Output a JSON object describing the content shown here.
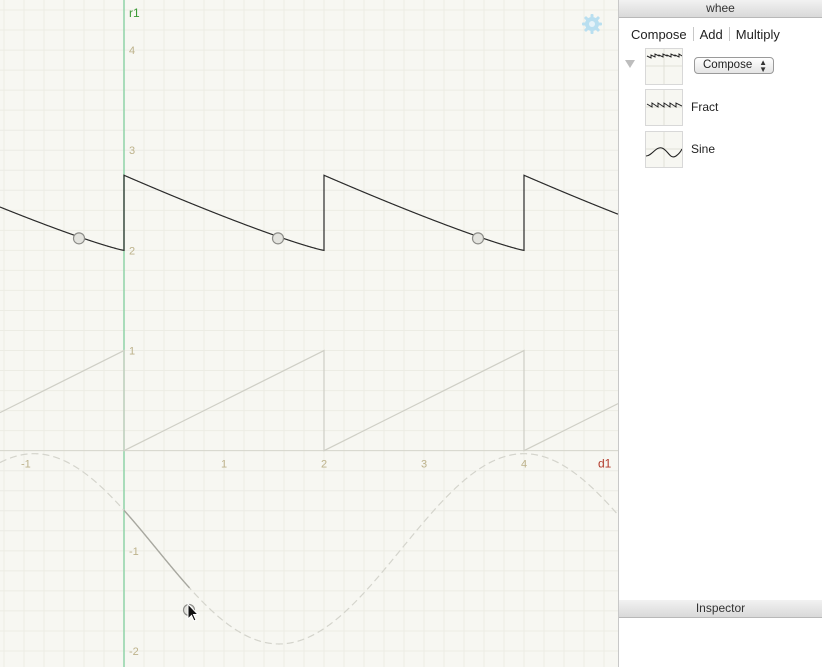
{
  "window": {
    "title": "whee"
  },
  "toolbar": {
    "compose": "Compose",
    "add": "Add",
    "multiply": "Multiply"
  },
  "functions": [
    {
      "label": "",
      "select": "Compose",
      "icon": "compose-icon"
    },
    {
      "label": "Fract",
      "icon": "fract-icon"
    },
    {
      "label": "Sine",
      "icon": "sine-icon"
    }
  ],
  "inspector": {
    "title": "Inspector"
  },
  "graph": {
    "x_axis_name": "d1",
    "y_axis_name": "r1",
    "x_ticks": [
      "-1",
      "1",
      "2",
      "3",
      "4"
    ],
    "y_ticks": [
      "4",
      "3",
      "2",
      "1",
      "-1",
      "-2"
    ],
    "settings_icon": "gear-icon"
  },
  "colors": {
    "background": "#f7f7f2",
    "grid": "#ecece4",
    "y_axis": "#8fd4a7",
    "tick": "#bdb28b",
    "x_axis_name": "#b23a2a",
    "y_axis_name": "#3a9a35"
  },
  "chart_data": {
    "type": "line",
    "x_range": [
      -1.24,
      4.94
    ],
    "y_range": [
      -2.16,
      4.5
    ],
    "series": [
      {
        "expression": "compose",
        "style": "solid dark"
      },
      {
        "expression": "fract",
        "style": "solid light"
      },
      {
        "expression": "sine",
        "style": "dashed light"
      }
    ],
    "handles": [
      {
        "x": -0.45,
        "y": 2.12
      },
      {
        "x": 1.54,
        "y": 2.12
      },
      {
        "x": 3.54,
        "y": 2.12
      },
      {
        "x": 0.65,
        "y": -1.59
      }
    ]
  }
}
